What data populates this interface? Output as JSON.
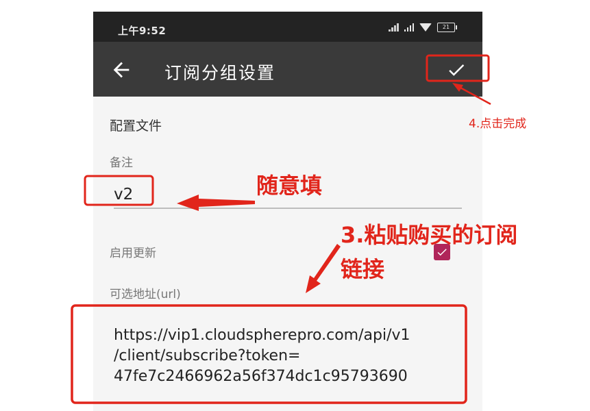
{
  "status_bar": {
    "time": "上午9:52",
    "battery": "21"
  },
  "toolbar": {
    "title": "订阅分组设置",
    "back_icon": "back-arrow-icon",
    "confirm_icon": "check-icon"
  },
  "form": {
    "section_title": "配置文件",
    "remark_label": "备注",
    "remark_value": "v2",
    "enable_update_label": "启用更新",
    "enable_update_checked": true,
    "url_label": "可选地址(url)",
    "url_value": "https://vip1.cloudspherepro.com/api/v1\n/client/subscribe?token=\n47fe7c2466962a56f374dc1c95793690"
  },
  "annotations": {
    "step4": "4.点击完成",
    "fill_any": "随意填",
    "step3": "3.粘贴购买的订阅\n链接",
    "color": "#e1251b"
  },
  "colors": {
    "toolbar_bg": "#3a3a3a",
    "status_bg": "#232323",
    "accent_checkbox": "#b0255a",
    "annotation_red": "#e1251b"
  }
}
